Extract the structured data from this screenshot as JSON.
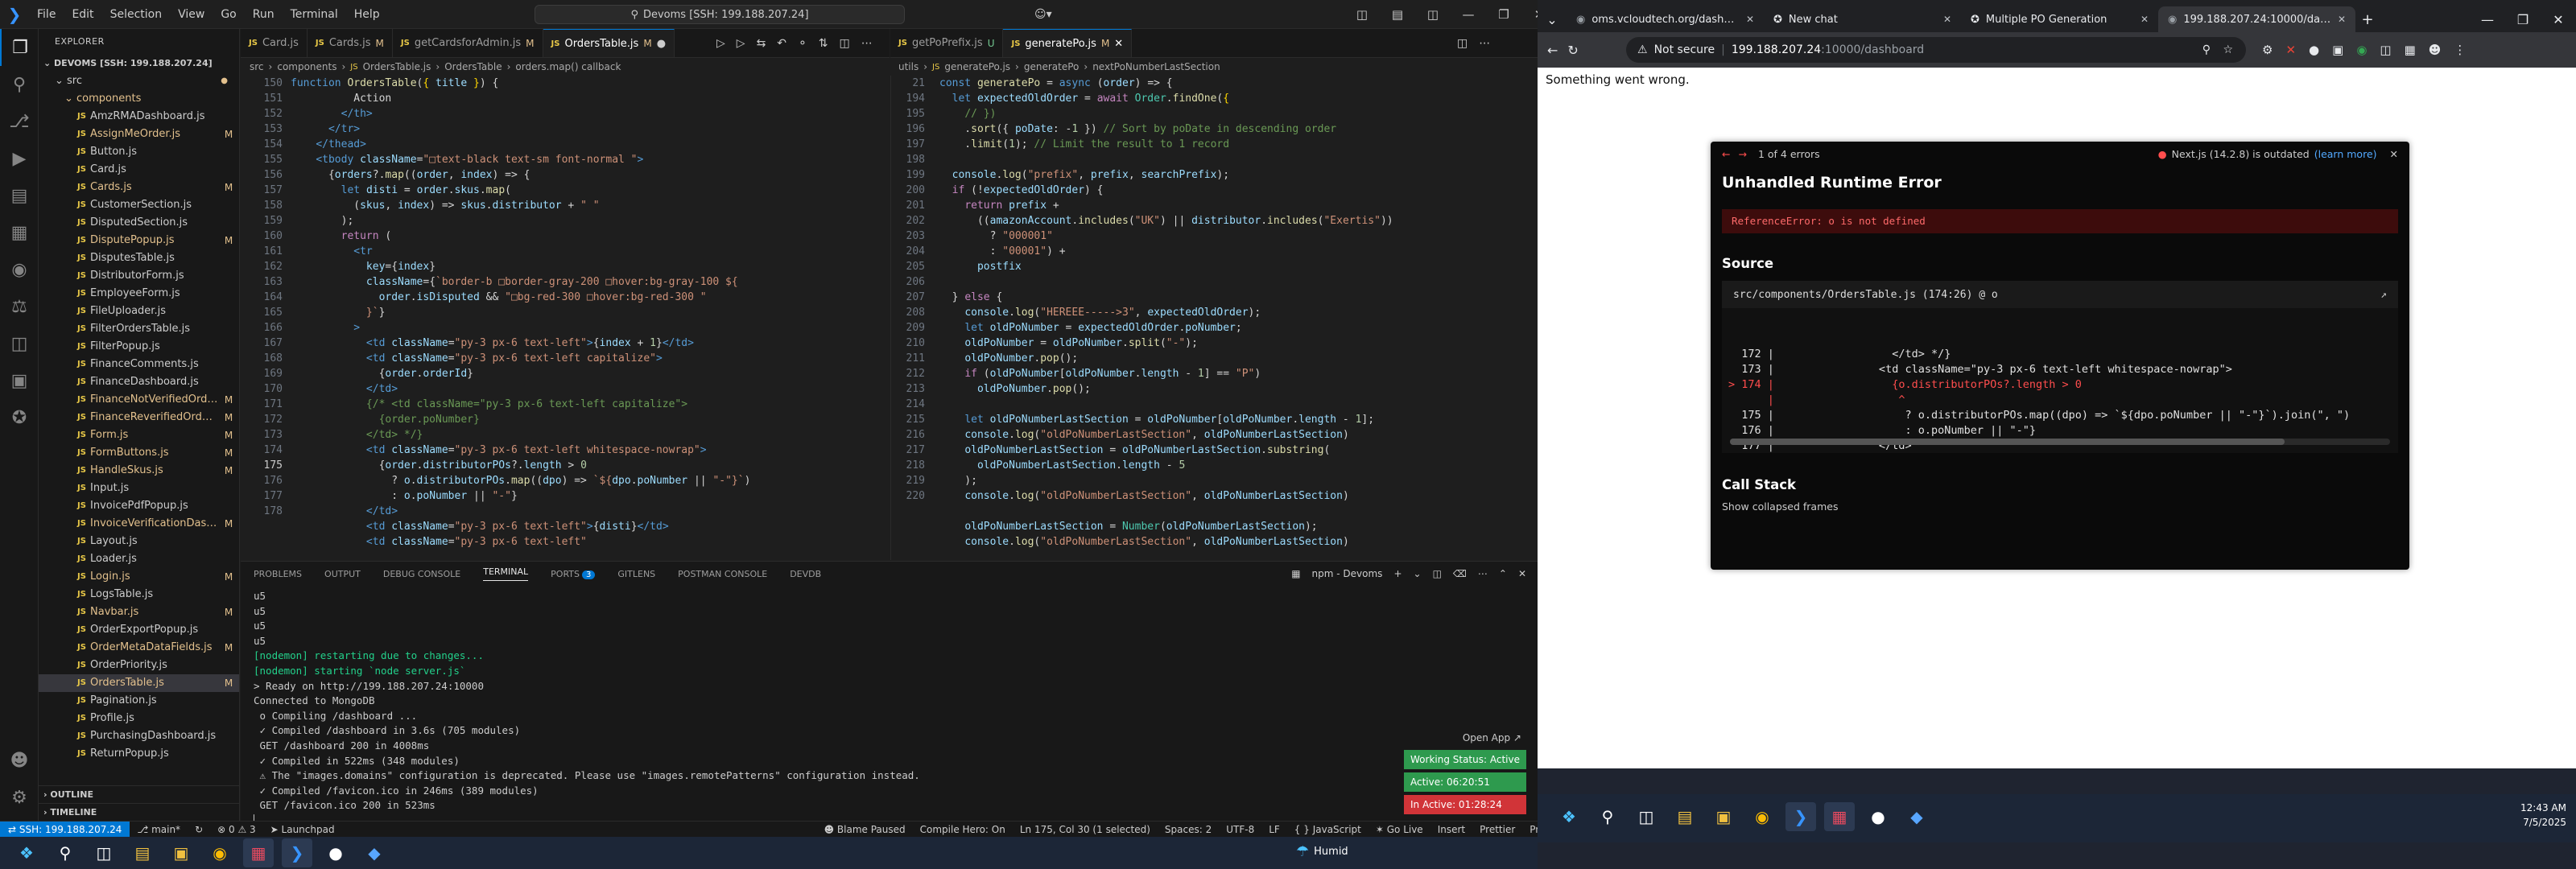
{
  "vscode": {
    "menu": [
      "File",
      "Edit",
      "Selection",
      "View",
      "Go",
      "Run",
      "Terminal",
      "Help"
    ],
    "command_center": "Devoms [SSH: 199.188.207.24]",
    "explorer": {
      "title": "EXPLORER",
      "root": "DEVOMS [SSH: 199.188.207.24]",
      "src": "src",
      "components": "components",
      "files": [
        {
          "name": "AmzRMADashboard.js",
          "status": ""
        },
        {
          "name": "AssignMeOrder.js",
          "status": "M"
        },
        {
          "name": "Button.js",
          "status": ""
        },
        {
          "name": "Card.js",
          "status": ""
        },
        {
          "name": "Cards.js",
          "status": "M"
        },
        {
          "name": "CustomerSection.js",
          "status": ""
        },
        {
          "name": "DisputedSection.js",
          "status": ""
        },
        {
          "name": "DisputePopup.js",
          "status": "M"
        },
        {
          "name": "DisputesTable.js",
          "status": ""
        },
        {
          "name": "DistributorForm.js",
          "status": ""
        },
        {
          "name": "EmployeeForm.js",
          "status": ""
        },
        {
          "name": "FileUploader.js",
          "status": ""
        },
        {
          "name": "FilterOrdersTable.js",
          "status": ""
        },
        {
          "name": "FilterPopup.js",
          "status": ""
        },
        {
          "name": "FinanceComments.js",
          "status": ""
        },
        {
          "name": "FinanceDashboard.js",
          "status": ""
        },
        {
          "name": "FinanceNotVerifiedOrderT...",
          "status": "M"
        },
        {
          "name": "FinanceReverifiedOrderTab...",
          "status": "M"
        },
        {
          "name": "Form.js",
          "status": "M"
        },
        {
          "name": "FormButtons.js",
          "status": "M"
        },
        {
          "name": "HandleSkus.js",
          "status": "M"
        },
        {
          "name": "Input.js",
          "status": ""
        },
        {
          "name": "InvoicePdfPopup.js",
          "status": ""
        },
        {
          "name": "InvoiceVerificationDashbo...",
          "status": "M"
        },
        {
          "name": "Layout.js",
          "status": ""
        },
        {
          "name": "Loader.js",
          "status": ""
        },
        {
          "name": "Login.js",
          "status": "M"
        },
        {
          "name": "LogsTable.js",
          "status": ""
        },
        {
          "name": "Navbar.js",
          "status": "M"
        },
        {
          "name": "OrderExportPopup.js",
          "status": ""
        },
        {
          "name": "OrderMetaDataFields.js",
          "status": "M"
        },
        {
          "name": "OrderPriority.js",
          "status": ""
        },
        {
          "name": "OrdersTable.js",
          "status": "M"
        },
        {
          "name": "Pagination.js",
          "status": ""
        },
        {
          "name": "Profile.js",
          "status": ""
        },
        {
          "name": "PurchasingDashboard.js",
          "status": ""
        },
        {
          "name": "ReturnPopup.js",
          "status": ""
        }
      ],
      "outline": "OUTLINE",
      "timeline": "TIMELINE"
    },
    "left_tabs": [
      {
        "label": "Card.js",
        "flag": ""
      },
      {
        "label": "Cards.js",
        "flag": "M"
      },
      {
        "label": "getCardsforAdmin.js",
        "flag": "M"
      },
      {
        "label": "OrdersTable.js",
        "flag": "M",
        "active": true
      }
    ],
    "right_tabs": [
      {
        "label": "getPoPrefix.js",
        "flag": "U"
      },
      {
        "label": "generatePo.js",
        "flag": "M",
        "active": true
      }
    ],
    "left_breadcrumb": [
      "src",
      "components",
      "OrdersTable.js",
      "OrdersTable",
      "orders.map() callback"
    ],
    "right_breadcrumb": [
      "utils",
      "generatePo.js",
      "generatePo",
      "nextPoNumberLastSection"
    ],
    "left_lines": [
      "150",
      "151",
      "152",
      "153",
      "154",
      "155",
      "156",
      "157",
      "158",
      "159",
      "160",
      "161",
      "162",
      "163",
      "164",
      "165",
      "166",
      "167",
      "168",
      "169",
      "170",
      "171",
      "172",
      "173",
      "174",
      "175",
      "176",
      "177",
      "178"
    ],
    "right_lines": [
      "21",
      "194",
      "195",
      "196",
      "197",
      "198",
      "199",
      "200",
      "201",
      "202",
      "203",
      "204",
      "205",
      "206",
      "207",
      "208",
      "209",
      "210",
      "211",
      "212",
      "213",
      "214",
      "215",
      "216",
      "217",
      "218",
      "219",
      "220"
    ],
    "panel_tabs": [
      "PROBLEMS",
      "OUTPUT",
      "DEBUG CONSOLE",
      "TERMINAL",
      "PORTS",
      "GITLENS",
      "POSTMAN CONSOLE",
      "DEVDB"
    ],
    "ports_badge": "3",
    "terminal_name": "npm - Devoms",
    "terminal_lines": [
      {
        "t": "u5",
        "c": ""
      },
      {
        "t": "u5",
        "c": ""
      },
      {
        "t": "u5",
        "c": ""
      },
      {
        "t": "u5",
        "c": ""
      },
      {
        "t": "[nodemon] restarting due to changes...",
        "c": "tg2"
      },
      {
        "t": "[nodemon] starting `node server.js`",
        "c": "tg2"
      },
      {
        "t": "> Ready on http://199.188.207.24:10000",
        "c": ""
      },
      {
        "t": "Connected to MongoDB",
        "c": ""
      },
      {
        "t": " o Compiling /dashboard ...",
        "c": ""
      },
      {
        "t": " ✓ Compiled /dashboard in 3.6s (705 modules)",
        "c": ""
      },
      {
        "t": " GET /dashboard 200 in 4008ms",
        "c": ""
      },
      {
        "t": " ✓ Compiled in 522ms (348 modules)",
        "c": ""
      },
      {
        "t": " ⚠ The \"images.domains\" configuration is deprecated. Please use \"images.remotePatterns\" configuration instead.",
        "c": ""
      },
      {
        "t": " ✓ Compiled /favicon.ico in 246ms (389 modules)",
        "c": ""
      },
      {
        "t": " GET /favicon.ico 200 in 523ms",
        "c": ""
      },
      {
        "t": "▏",
        "c": ""
      }
    ],
    "work_status": {
      "open_app": "Open App ↗",
      "working": "Working Status: Active",
      "active": "Active: 06:20:51",
      "inactive": "In Active: 01:28:24"
    },
    "status_bar": {
      "remote": "SSH: 199.188.207.24",
      "branch": "main*",
      "errors": "⊗ 0 ⚠ 3",
      "launchpad": "Launchpad",
      "blame": "Blame Paused",
      "hero": "Compile Hero: On",
      "cursor": "Ln 175, Col 30 (1 selected)",
      "spaces": "Spaces: 2",
      "encoding": "UTF-8",
      "eol": "LF",
      "lang": "{ } JavaScript",
      "golive": "Go Live",
      "insert": "Insert",
      "prettier": "Prettier",
      "prettier2": "Prettier"
    },
    "weather": "Humid"
  },
  "browser": {
    "tabs": [
      {
        "title": "oms.vcloudtech.org/dashboard",
        "active": false
      },
      {
        "title": "New chat",
        "active": false
      },
      {
        "title": "Multiple PO Generation",
        "active": false
      },
      {
        "title": "199.188.207.24:10000/dashbo...",
        "active": true
      }
    ],
    "not_secure": "Not secure",
    "url_host": "199.188.207.24",
    "url_path": ":10000/dashboard",
    "page_text": "Something went wrong.",
    "error": {
      "count": "1 of 4 errors",
      "next_status": "Next.js (14.2.8) is outdated",
      "learn_more": "(learn more)",
      "title": "Unhandled Runtime Error",
      "message": "ReferenceError: o is not defined",
      "source_heading": "Source",
      "source_file": "src/components/OrdersTable.js (174:26) @ o",
      "source_lines": [
        "  172 |                  </td> */}",
        "  173 |                <td className=\"py-3 px-6 text-left whitespace-nowrap\">",
        "> 174 |                  {o.distributorPOs?.length > 0",
        "      |                   ^",
        "  175 |                    ? o.distributorPOs.map((dpo) => `${dpo.poNumber || \"-\"}`).join(\", \")",
        "  176 |                    : o.poNumber || \"-\"}",
        "  177 |                </td>"
      ],
      "call_stack": "Call Stack",
      "collapsed": "Show collapsed frames"
    },
    "clock": {
      "time": "12:43 AM",
      "date": "7/5/2025"
    }
  }
}
